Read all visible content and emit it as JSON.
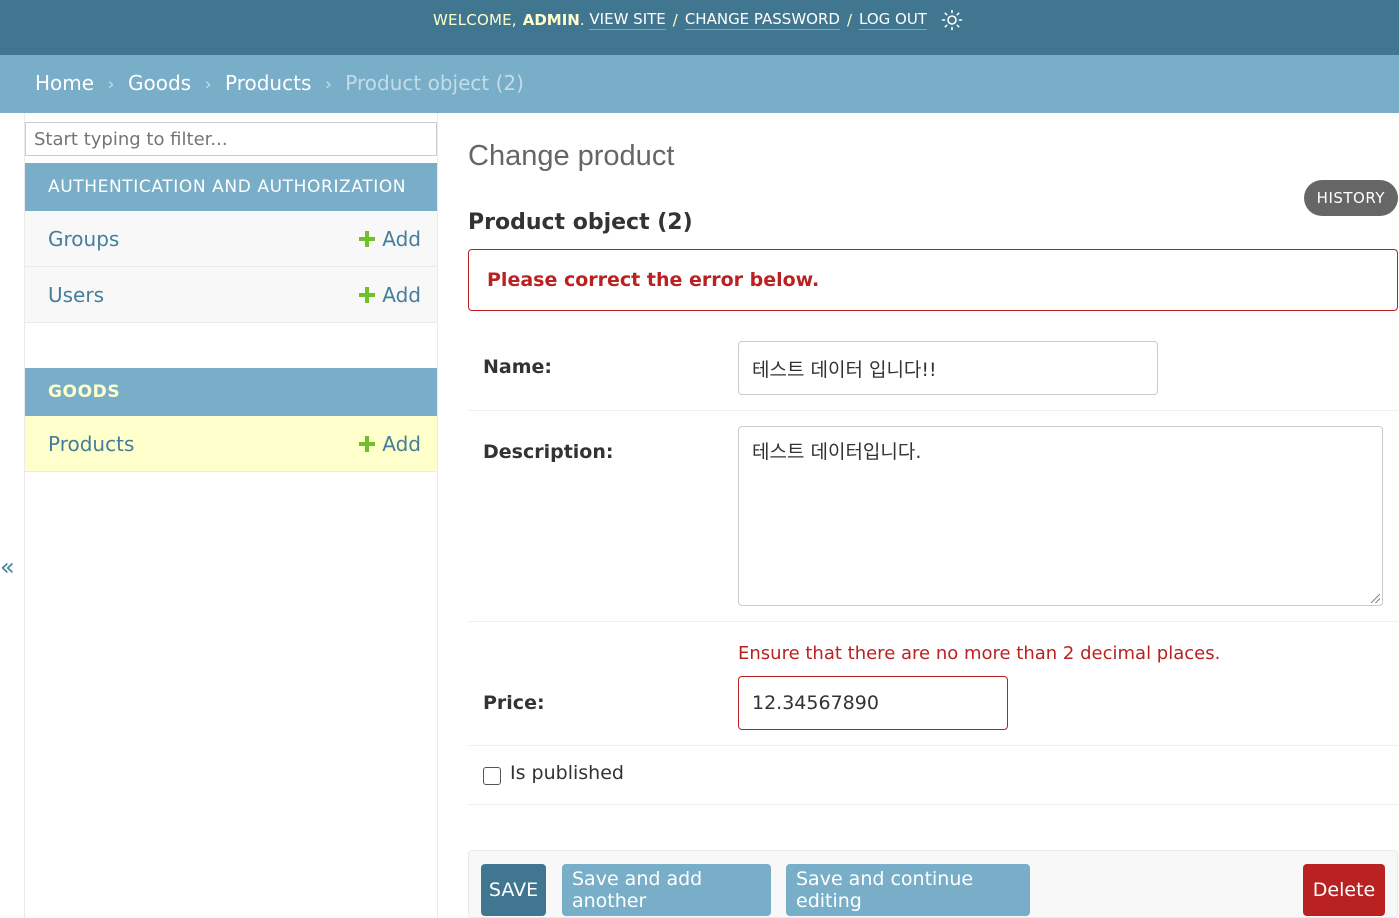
{
  "header": {
    "welcome": "WELCOME,",
    "user": "ADMIN",
    "view_site": "VIEW SITE",
    "change_password": "CHANGE PASSWORD",
    "log_out": "LOG OUT",
    "separator": "/"
  },
  "breadcrumbs": {
    "home": "Home",
    "app": "Goods",
    "model": "Products",
    "current": "Product object (2)",
    "arrow": "›"
  },
  "sidebar": {
    "filter_placeholder": "Start typing to filter...",
    "collapse": "«",
    "modules": [
      {
        "caption": "AUTHENTICATION AND AUTHORIZATION",
        "items": [
          {
            "label": "Groups",
            "add": "Add"
          },
          {
            "label": "Users",
            "add": "Add"
          }
        ]
      },
      {
        "caption": "GOODS",
        "items": [
          {
            "label": "Products",
            "add": "Add"
          }
        ]
      }
    ]
  },
  "main": {
    "title": "Change product",
    "history": "HISTORY",
    "object_title": "Product object (2)",
    "error_note": "Please correct the error below.",
    "fields": {
      "name": {
        "label": "Name:",
        "value": "테스트 데이터 입니다!!"
      },
      "description": {
        "label": "Description:",
        "value": "테스트 데이터입니다."
      },
      "price": {
        "label": "Price:",
        "value": "12.34567890",
        "error": "Ensure that there are no more than 2 decimal places."
      },
      "is_published": {
        "label": "Is published",
        "checked": false
      }
    },
    "buttons": {
      "save": "SAVE",
      "save_add": "Save and add another",
      "save_continue": "Save and continue editing",
      "delete": "Delete"
    }
  },
  "colors": {
    "header": "#417690",
    "breadcrumbs": "#79aec8",
    "error": "#ba2121",
    "add_icon": "#70bf2b",
    "active_row": "#ffffcc"
  }
}
